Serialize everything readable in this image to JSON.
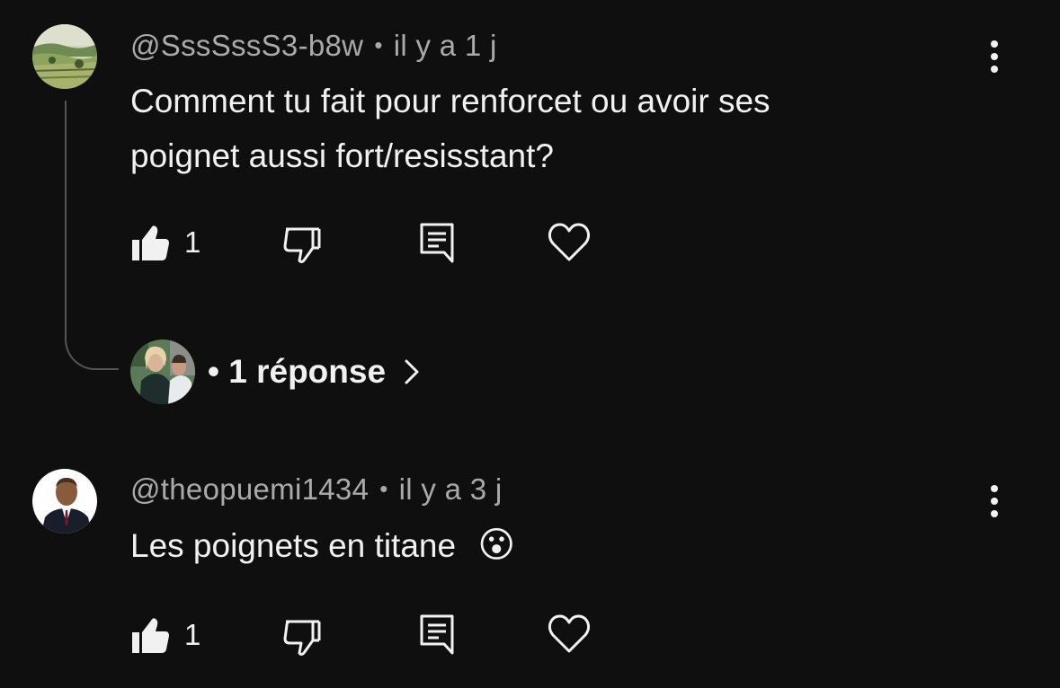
{
  "comments": [
    {
      "author": "@SssSssS3-b8w",
      "separator": "•",
      "time": "il y a 1 j",
      "text_line1": "Comment tu fait pour renforcet ou avoir ses",
      "text_line2": "poignet aussi fort/resisstant?",
      "likes": "1",
      "replies": {
        "dot": "•",
        "label": "1 réponse"
      }
    },
    {
      "author": "@theopuemi1434",
      "separator": "•",
      "time": "il y a 3 j",
      "text": "Les poignets en titane",
      "emoji": "😮",
      "likes": "1"
    }
  ],
  "icons": {
    "like": "thumb-up-icon",
    "dislike": "thumb-down-icon",
    "reply": "comment-icon",
    "heart": "heart-icon",
    "more": "more-vertical-icon",
    "chevron": "chevron-right-icon"
  },
  "colors": {
    "background": "#0f0f0f",
    "primary_text": "#f1f1f1",
    "secondary_text": "#aaaaaa",
    "thread_line": "#555555"
  }
}
